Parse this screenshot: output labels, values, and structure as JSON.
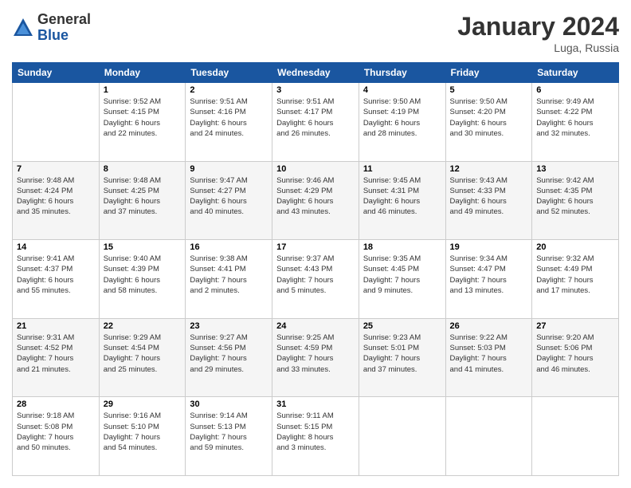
{
  "header": {
    "logo_general": "General",
    "logo_blue": "Blue",
    "month_title": "January 2024",
    "location": "Luga, Russia"
  },
  "days_of_week": [
    "Sunday",
    "Monday",
    "Tuesday",
    "Wednesday",
    "Thursday",
    "Friday",
    "Saturday"
  ],
  "weeks": [
    [
      {
        "day": "",
        "info": ""
      },
      {
        "day": "1",
        "info": "Sunrise: 9:52 AM\nSunset: 4:15 PM\nDaylight: 6 hours\nand 22 minutes."
      },
      {
        "day": "2",
        "info": "Sunrise: 9:51 AM\nSunset: 4:16 PM\nDaylight: 6 hours\nand 24 minutes."
      },
      {
        "day": "3",
        "info": "Sunrise: 9:51 AM\nSunset: 4:17 PM\nDaylight: 6 hours\nand 26 minutes."
      },
      {
        "day": "4",
        "info": "Sunrise: 9:50 AM\nSunset: 4:19 PM\nDaylight: 6 hours\nand 28 minutes."
      },
      {
        "day": "5",
        "info": "Sunrise: 9:50 AM\nSunset: 4:20 PM\nDaylight: 6 hours\nand 30 minutes."
      },
      {
        "day": "6",
        "info": "Sunrise: 9:49 AM\nSunset: 4:22 PM\nDaylight: 6 hours\nand 32 minutes."
      }
    ],
    [
      {
        "day": "7",
        "info": "Sunrise: 9:48 AM\nSunset: 4:24 PM\nDaylight: 6 hours\nand 35 minutes."
      },
      {
        "day": "8",
        "info": "Sunrise: 9:48 AM\nSunset: 4:25 PM\nDaylight: 6 hours\nand 37 minutes."
      },
      {
        "day": "9",
        "info": "Sunrise: 9:47 AM\nSunset: 4:27 PM\nDaylight: 6 hours\nand 40 minutes."
      },
      {
        "day": "10",
        "info": "Sunrise: 9:46 AM\nSunset: 4:29 PM\nDaylight: 6 hours\nand 43 minutes."
      },
      {
        "day": "11",
        "info": "Sunrise: 9:45 AM\nSunset: 4:31 PM\nDaylight: 6 hours\nand 46 minutes."
      },
      {
        "day": "12",
        "info": "Sunrise: 9:43 AM\nSunset: 4:33 PM\nDaylight: 6 hours\nand 49 minutes."
      },
      {
        "day": "13",
        "info": "Sunrise: 9:42 AM\nSunset: 4:35 PM\nDaylight: 6 hours\nand 52 minutes."
      }
    ],
    [
      {
        "day": "14",
        "info": "Sunrise: 9:41 AM\nSunset: 4:37 PM\nDaylight: 6 hours\nand 55 minutes."
      },
      {
        "day": "15",
        "info": "Sunrise: 9:40 AM\nSunset: 4:39 PM\nDaylight: 6 hours\nand 58 minutes."
      },
      {
        "day": "16",
        "info": "Sunrise: 9:38 AM\nSunset: 4:41 PM\nDaylight: 7 hours\nand 2 minutes."
      },
      {
        "day": "17",
        "info": "Sunrise: 9:37 AM\nSunset: 4:43 PM\nDaylight: 7 hours\nand 5 minutes."
      },
      {
        "day": "18",
        "info": "Sunrise: 9:35 AM\nSunset: 4:45 PM\nDaylight: 7 hours\nand 9 minutes."
      },
      {
        "day": "19",
        "info": "Sunrise: 9:34 AM\nSunset: 4:47 PM\nDaylight: 7 hours\nand 13 minutes."
      },
      {
        "day": "20",
        "info": "Sunrise: 9:32 AM\nSunset: 4:49 PM\nDaylight: 7 hours\nand 17 minutes."
      }
    ],
    [
      {
        "day": "21",
        "info": "Sunrise: 9:31 AM\nSunset: 4:52 PM\nDaylight: 7 hours\nand 21 minutes."
      },
      {
        "day": "22",
        "info": "Sunrise: 9:29 AM\nSunset: 4:54 PM\nDaylight: 7 hours\nand 25 minutes."
      },
      {
        "day": "23",
        "info": "Sunrise: 9:27 AM\nSunset: 4:56 PM\nDaylight: 7 hours\nand 29 minutes."
      },
      {
        "day": "24",
        "info": "Sunrise: 9:25 AM\nSunset: 4:59 PM\nDaylight: 7 hours\nand 33 minutes."
      },
      {
        "day": "25",
        "info": "Sunrise: 9:23 AM\nSunset: 5:01 PM\nDaylight: 7 hours\nand 37 minutes."
      },
      {
        "day": "26",
        "info": "Sunrise: 9:22 AM\nSunset: 5:03 PM\nDaylight: 7 hours\nand 41 minutes."
      },
      {
        "day": "27",
        "info": "Sunrise: 9:20 AM\nSunset: 5:06 PM\nDaylight: 7 hours\nand 46 minutes."
      }
    ],
    [
      {
        "day": "28",
        "info": "Sunrise: 9:18 AM\nSunset: 5:08 PM\nDaylight: 7 hours\nand 50 minutes."
      },
      {
        "day": "29",
        "info": "Sunrise: 9:16 AM\nSunset: 5:10 PM\nDaylight: 7 hours\nand 54 minutes."
      },
      {
        "day": "30",
        "info": "Sunrise: 9:14 AM\nSunset: 5:13 PM\nDaylight: 7 hours\nand 59 minutes."
      },
      {
        "day": "31",
        "info": "Sunrise: 9:11 AM\nSunset: 5:15 PM\nDaylight: 8 hours\nand 3 minutes."
      },
      {
        "day": "",
        "info": ""
      },
      {
        "day": "",
        "info": ""
      },
      {
        "day": "",
        "info": ""
      }
    ]
  ]
}
